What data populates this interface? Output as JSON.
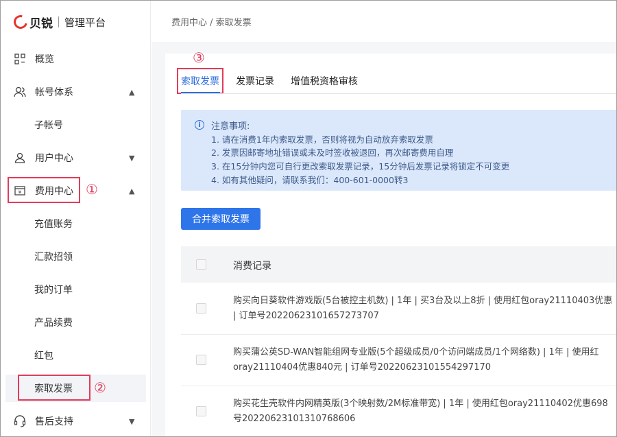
{
  "brand": {
    "name": "贝锐",
    "subtitle": "管理平台"
  },
  "sidebar": {
    "items": [
      {
        "label": "概览",
        "icon": "grid-icon"
      },
      {
        "label": "帐号体系",
        "icon": "users-icon",
        "chevron": "▲"
      },
      {
        "label": "子帐号"
      },
      {
        "label": "用户中心",
        "icon": "user-icon",
        "chevron": "▼"
      },
      {
        "label": "费用中心",
        "icon": "bill-icon",
        "chevron": "▲"
      },
      {
        "label": "充值账务"
      },
      {
        "label": "汇款招领"
      },
      {
        "label": "我的订单"
      },
      {
        "label": "产品续费"
      },
      {
        "label": "红包"
      },
      {
        "label": "索取发票"
      },
      {
        "label": "售后支持",
        "icon": "headset-icon",
        "chevron": "▼"
      }
    ]
  },
  "annotations": {
    "one": "①",
    "two": "②",
    "three": "③"
  },
  "breadcrumb": "费用中心 / 索取发票",
  "tabs": [
    "索取发票",
    "发票记录",
    "增值税资格审核"
  ],
  "notice": {
    "title": "注意事项:",
    "lines": [
      "1. 请在消费1年内索取发票，否则将视为自动放弃索取发票",
      "2. 发票因邮寄地址错误或未及时签收被退回，再次邮寄费用自理",
      "3. 在15分钟内您可自行更改索取发票记录，15分钟后发票记录将锁定不可变更",
      "4. 如有其他疑问，请联系我们：400-601-0000转3"
    ]
  },
  "merge_button": "合并索取发票",
  "table": {
    "header": "消费记录",
    "rows": [
      {
        "line1": "购买向日葵软件游戏版(5台被控主机数) | 1年 | 买3台及以上8折 | 使用红包oray21110403优惠",
        "line2": "| 订单号20220623101657273707"
      },
      {
        "line1": "购买蒲公英SD-WAN智能组网专业版(5个超级成员/0个访问端成员/1个网络数) | 1年 | 使用红",
        "line2": "oray21110404优惠840元 | 订单号20220623101554297170"
      },
      {
        "line1": "购买花生壳软件内网精英版(3个映射数/2M标准带宽) | 1年 | 使用红包oray21110402优惠698",
        "line2": "号20220623101310768606"
      }
    ]
  },
  "colors": {
    "accent": "#2f75ea",
    "annotation": "#e03c5a",
    "notice_bg": "#dbe8fb"
  }
}
